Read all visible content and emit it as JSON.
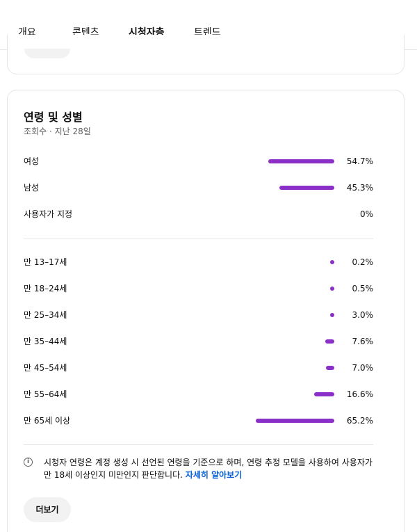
{
  "tabs": [
    {
      "label": "개요",
      "active": false
    },
    {
      "label": "콘텐츠",
      "active": false
    },
    {
      "label": "시청자층",
      "active": true
    },
    {
      "label": "트렌드",
      "active": false
    }
  ],
  "card": {
    "title": "연령 및 성별",
    "subtitle": "조회수 · 지난 28일"
  },
  "accent_color": "#8b2fc9",
  "gender": [
    {
      "label": "여성",
      "percent": 54.7,
      "value": "54.7%"
    },
    {
      "label": "남성",
      "percent": 45.3,
      "value": "45.3%"
    },
    {
      "label": "사용자가 지정",
      "percent": 0,
      "value": "0%"
    }
  ],
  "age": [
    {
      "label": "만 13–17세",
      "percent": 0.2,
      "value": "0.2%"
    },
    {
      "label": "만 18–24세",
      "percent": 0.5,
      "value": "0.5%"
    },
    {
      "label": "만 25–34세",
      "percent": 3.0,
      "value": "3.0%"
    },
    {
      "label": "만 35–44세",
      "percent": 7.6,
      "value": "7.6%"
    },
    {
      "label": "만 45–54세",
      "percent": 7.0,
      "value": "7.0%"
    },
    {
      "label": "만 55–64세",
      "percent": 16.6,
      "value": "16.6%"
    },
    {
      "label": "만 65세 이상",
      "percent": 65.2,
      "value": "65.2%"
    }
  ],
  "note": {
    "text": "시청자 연령은 계정 생성 시 선언된 연령을 기준으로 하며, 연령 추정 모델을 사용하여 사용자가 만 18세 이상인지 미만인지 판단합니다.",
    "link": "자세히 알아보기",
    "icon": "info-icon"
  },
  "more_button": "더보기"
}
